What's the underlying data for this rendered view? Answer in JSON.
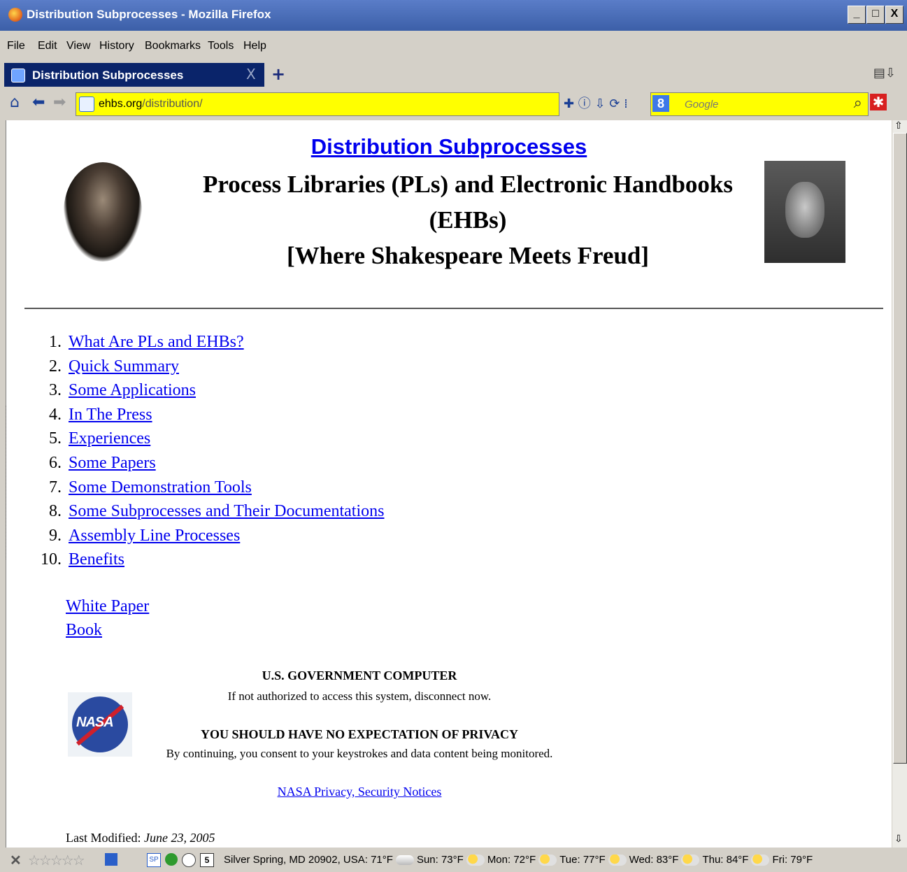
{
  "window": {
    "title": "Distribution Subprocesses - Mozilla Firefox",
    "min": "_",
    "max": "□",
    "close": "X"
  },
  "menu": [
    "File",
    "Edit",
    "View",
    "History",
    "Bookmarks",
    "Tools",
    "Help"
  ],
  "tab": {
    "label": "Distribution Subprocesses",
    "close": "X",
    "new": "+"
  },
  "url": {
    "host": "ehbs.org",
    "path": "/distribution/"
  },
  "search": {
    "engine": "8",
    "placeholder": "Google"
  },
  "page": {
    "heading_link": "Distribution Subprocesses",
    "subtitle_line1": "Process Libraries (PLs) and Electronic Handbooks",
    "subtitle_line2": "(EHBs)",
    "subtitle_line3": "[Where Shakespeare Meets Freud]",
    "toc": [
      "What Are PLs and EHBs?",
      "Quick Summary",
      "Some Applications",
      "In The Press",
      "Experiences",
      "Some Papers",
      "Some Demonstration Tools",
      "Some Subprocesses and Their Documentations",
      "Assembly Line Processes",
      "Benefits"
    ],
    "extra_links": [
      "White Paper",
      "Book"
    ],
    "gov_title": "U.S. GOVERNMENT COMPUTER",
    "gov_line1": "If not authorized to access this system, disconnect now.",
    "privacy_title": "YOU SHOULD HAVE NO EXPECTATION OF PRIVACY",
    "privacy_line": "By continuing, you consent to your keystrokes and data content being monitored.",
    "nasa_link": "NASA Privacy, Security Notices",
    "nasa_logo_text": "NASA",
    "last_modified_label": "Last Modified:",
    "last_modified_date": "June 23, 2005"
  },
  "status": {
    "sp": "SP",
    "calendar": "5",
    "weather_location": "Silver Spring, MD 20902, USA: 71°F",
    "forecast": [
      "Sun: 73°F",
      "Mon: 72°F",
      "Tue: 77°F",
      "Wed: 83°F",
      "Thu: 84°F",
      "Fri: 79°F"
    ]
  }
}
